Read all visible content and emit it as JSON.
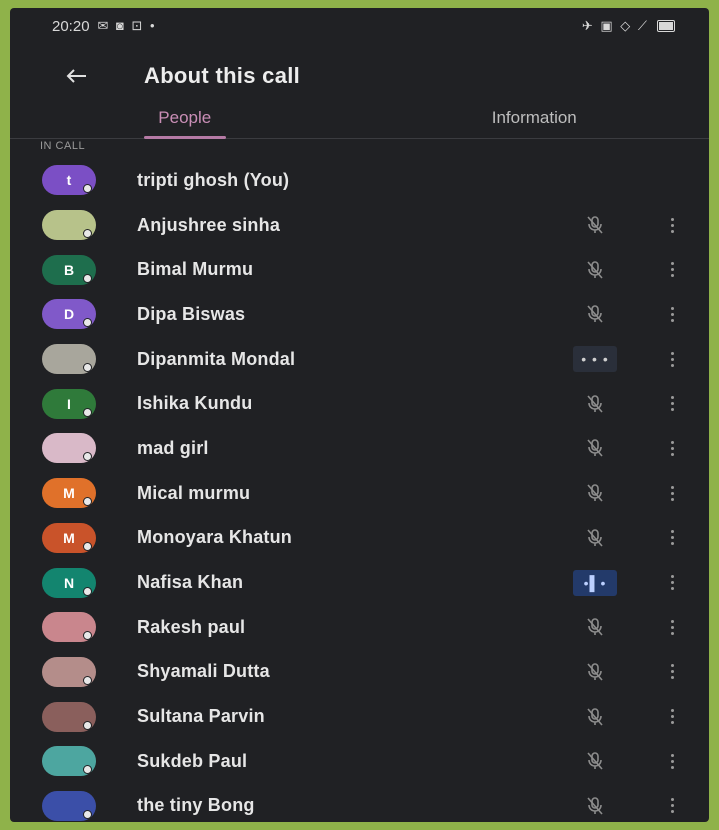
{
  "status_bar": {
    "time": "20:20",
    "icons_left": "✉ ◙ ⊡ •",
    "icons_right": "✈ ▣ ◇ ⟋"
  },
  "app_bar": {
    "back_icon": "arrow-left-icon",
    "title": "About this call"
  },
  "tabs": [
    {
      "label": "People",
      "active": true
    },
    {
      "label": "Information",
      "active": false
    }
  ],
  "section_label": "IN CALL",
  "participants": [
    {
      "name": "tripti ghosh (You)",
      "initial": "t",
      "avatar_color": "#7b4fc5",
      "mic": ""
    },
    {
      "name": "Anjushree sinha",
      "initial": "",
      "avatar_color": "#b7c28a",
      "mic": "muted"
    },
    {
      "name": "Bimal Murmu",
      "initial": "B",
      "avatar_color": "#1e6e4d",
      "mic": "muted"
    },
    {
      "name": "Dipa Biswas",
      "initial": "D",
      "avatar_color": "#8059c9",
      "mic": "muted"
    },
    {
      "name": "Dipanmita Mondal",
      "initial": "",
      "avatar_color": "#a8a69c",
      "mic": "speaking",
      "mic_text": "• • •"
    },
    {
      "name": "Ishika Kundu",
      "initial": "I",
      "avatar_color": "#2f7a3a",
      "mic": "muted"
    },
    {
      "name": "mad girl",
      "initial": "",
      "avatar_color": "#d9b9c8",
      "mic": "muted"
    },
    {
      "name": "Mical murmu",
      "initial": "M",
      "avatar_color": "#e0712a",
      "mic": "muted"
    },
    {
      "name": "Monoyara Khatun",
      "initial": "M",
      "avatar_color": "#c9532a",
      "mic": "muted"
    },
    {
      "name": "Nafisa Khan",
      "initial": "N",
      "avatar_color": "#13856f",
      "mic": "active",
      "mic_text": "•▌•"
    },
    {
      "name": "Rakesh paul",
      "initial": "",
      "avatar_color": "#c9868d",
      "mic": "muted"
    },
    {
      "name": "Shyamali Dutta",
      "initial": "",
      "avatar_color": "#b48d8a",
      "mic": "muted"
    },
    {
      "name": "Sultana Parvin",
      "initial": "",
      "avatar_color": "#8a5f5c",
      "mic": "muted"
    },
    {
      "name": "Sukdeb Paul",
      "initial": "",
      "avatar_color": "#4da6a0",
      "mic": "muted"
    },
    {
      "name": "the tiny Bong",
      "initial": "",
      "avatar_color": "#3b4fa8",
      "mic": "muted"
    }
  ]
}
